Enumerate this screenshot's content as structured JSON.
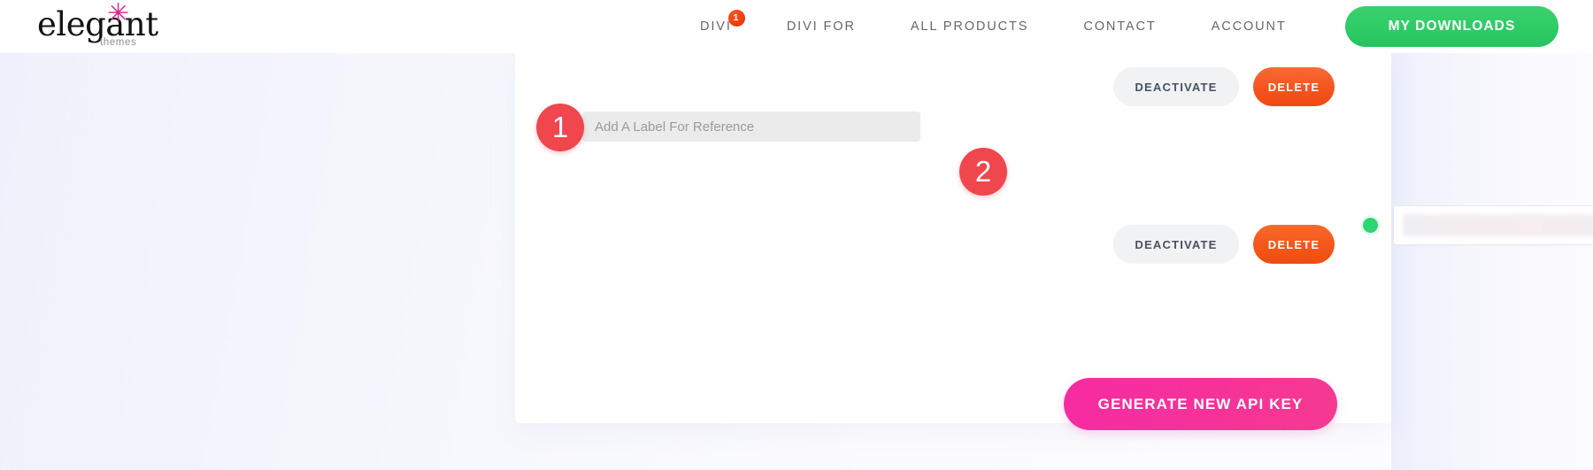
{
  "header": {
    "logo": {
      "word": "elegant",
      "star": "✳",
      "sub": "themes"
    },
    "nav_items": [
      {
        "label": "DIVI",
        "badge": "1"
      },
      {
        "label": "DIVI FOR",
        "badge": ""
      },
      {
        "label": "ALL PRODUCTS",
        "badge": ""
      },
      {
        "label": "CONTACT",
        "badge": ""
      },
      {
        "label": "ACCOUNT",
        "badge": ""
      }
    ],
    "downloads_button": "MY DOWNLOADS"
  },
  "card": {
    "row_top": {
      "deactivate_label": "DEACTIVATE",
      "delete_label": "DELETE"
    },
    "label_input": {
      "placeholder": "Add A Label For Reference",
      "value": ""
    },
    "api_key_row": {
      "status": "active",
      "key_value": ""
    },
    "row_bottom": {
      "deactivate_label": "DEACTIVATE",
      "delete_label": "DELETE"
    },
    "generate_button": "GENERATE NEW API KEY"
  },
  "annotations": {
    "marker_1": "1",
    "marker_2": "2"
  },
  "colors": {
    "accent_green": "#2ecc66",
    "accent_pink": "#f62d9d",
    "accent_orange": "#f4581c",
    "marker_red": "#f0464d",
    "status_green": "#2ed573",
    "page_bg": "#f4f6fd"
  }
}
